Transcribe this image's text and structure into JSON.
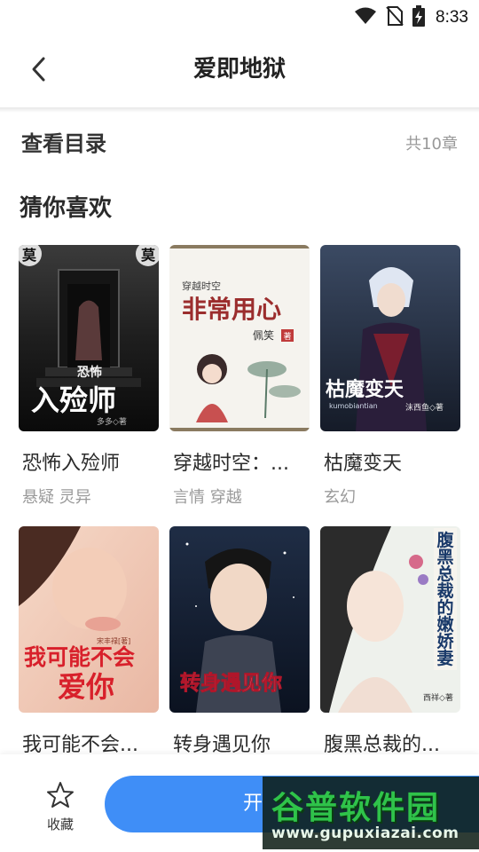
{
  "status_bar": {
    "time": "8:33",
    "icons": [
      "wifi-icon",
      "no-sim-icon",
      "battery-charging-icon"
    ]
  },
  "header": {
    "title": "爱即地狱",
    "back_icon": "chevron-left-icon"
  },
  "catalog": {
    "label": "查看目录",
    "count": "共10章"
  },
  "recommend": {
    "title": "猜你喜欢",
    "books": [
      {
        "title": "恐怖入殓师",
        "tags": "悬疑 灵异"
      },
      {
        "title": "穿越时空：...",
        "tags": "言情 穿越"
      },
      {
        "title": "枯魔变天",
        "tags": "玄幻"
      },
      {
        "title": "我可能不会...",
        "tags": ""
      },
      {
        "title": "转身遇见你",
        "tags": ""
      },
      {
        "title": "腹黑总裁的...",
        "tags": ""
      }
    ]
  },
  "covers": {
    "c1": {
      "badge_left": "莫",
      "badge_right": "莫",
      "small": "恐怖",
      "big": "入殓师",
      "author": "多多◇著"
    },
    "c2": {
      "top": "穿越时空",
      "big": "非常用心",
      "author": "佩笑",
      "seal": "著"
    },
    "c3": {
      "big": "枯魔变天",
      "pinyin": "kumobiantian",
      "author": "沫西鱼◇著"
    },
    "c4": {
      "author": "宋丰禄[著]",
      "big1": "我可能不会",
      "big2": "爱你"
    },
    "c5": {
      "big": "转身遇见你"
    },
    "c6": {
      "big": "腹黑总裁的嫩娇妻",
      "author": "西祥◇著"
    }
  },
  "bottom_bar": {
    "collect_label": "收藏",
    "collect_icon": "star-outline-icon",
    "read_label": "开"
  },
  "watermark": {
    "main": "谷普软件园",
    "url": "www.gupuxiazai.com"
  },
  "colors": {
    "accent": "#3f8ef7",
    "text_primary": "#2b2b2b",
    "text_secondary": "#9a9a9a"
  }
}
